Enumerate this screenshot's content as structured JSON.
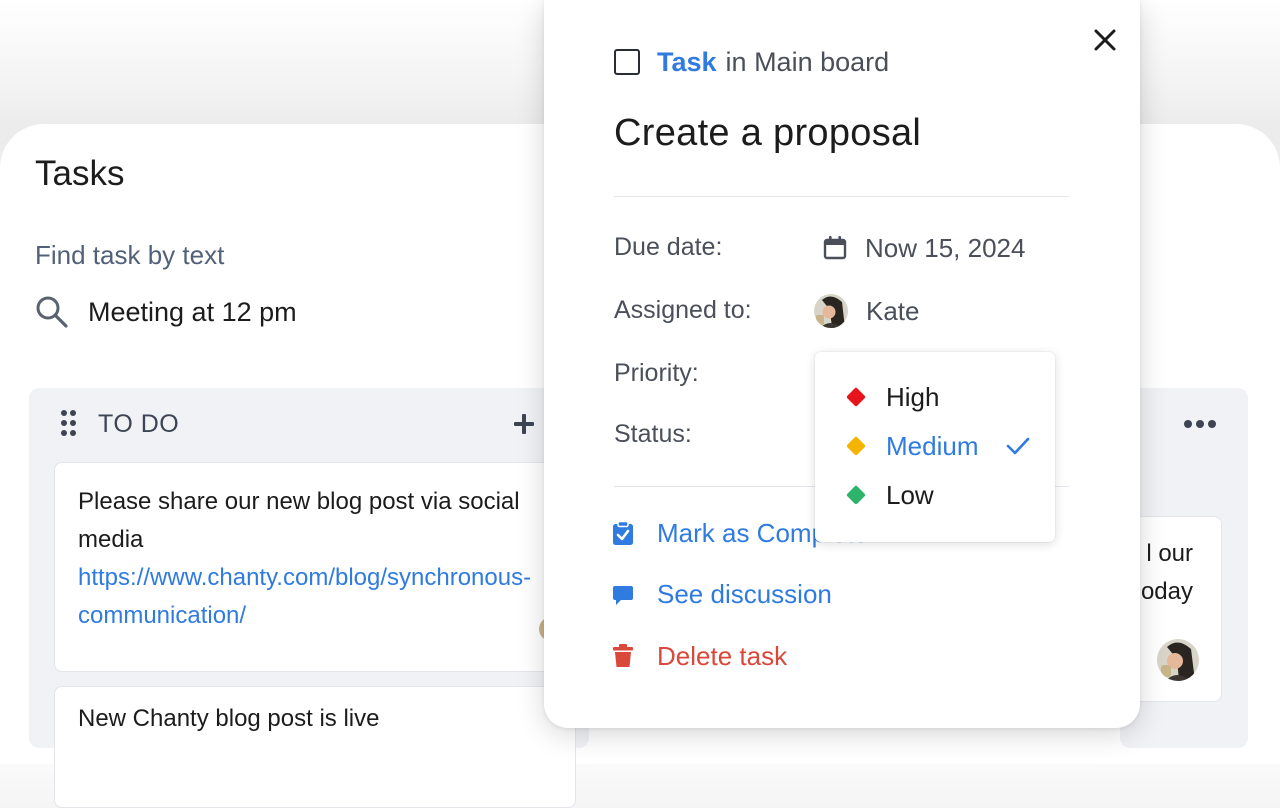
{
  "board": {
    "title": "Tasks",
    "search": {
      "label": "Find task by text",
      "value": "Meeting at 12 pm"
    },
    "columns": [
      {
        "title": "TO DO",
        "cards": [
          {
            "text": "Please share our new blog post via social media",
            "link": "https://www.chanty.com/blog/synchronous-communication/"
          },
          {
            "text": "New Chanty blog post is live"
          }
        ]
      },
      {
        "cards": [
          {
            "text": "l our",
            "text2": "oday"
          }
        ]
      }
    ]
  },
  "task_modal": {
    "type_label": "Task",
    "board_label": "in Main board",
    "title": "Create a proposal",
    "fields": {
      "due_date_label": "Due date:",
      "due_date_value": "Now 15, 2024",
      "assigned_label": "Assigned to:",
      "assigned_value": "Kate",
      "priority_label": "Priority:",
      "status_label": "Status:"
    },
    "actions": {
      "complete": "Mark as Complete",
      "discussion": "See discussion",
      "delete": "Delete task"
    },
    "priority_dropdown": {
      "options": [
        {
          "label": "High",
          "color": "#e8141c"
        },
        {
          "label": "Medium",
          "color": "#f5b400",
          "selected": true
        },
        {
          "label": "Low",
          "color": "#2db36a"
        }
      ]
    }
  },
  "colors": {
    "accent": "#2f7be0",
    "danger": "#d9483b"
  }
}
